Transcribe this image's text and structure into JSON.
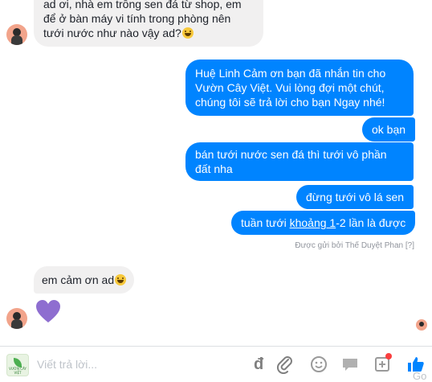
{
  "messages": {
    "incoming_1": {
      "line1": "ad ơi, nhà em trồng sen đá từ shop, em",
      "line2": "để ở bàn máy vi tính trong phòng nên",
      "line3": "tưới nước như nào vậy ad?"
    },
    "outgoing": [
      {
        "lines": [
          "Huệ Linh Cảm ơn bạn đã nhắn tin cho",
          "Vườn Cây Việt. Vui lòng đợi một chút,",
          "chúng tôi sẽ trả lời cho bạn Ngay nhé!"
        ]
      },
      {
        "lines": [
          "ok bạn"
        ]
      },
      {
        "lines": [
          "bán tưới nước sen đá thì tưới vô phần",
          "đất nha"
        ]
      },
      {
        "lines": [
          "đừng tưới vô lá sen"
        ]
      }
    ],
    "last_outgoing": {
      "before": "tuần tưới ",
      "underlined": "khoảng 1",
      "after": "-2 lần là được"
    },
    "sent_by": "Được gửi bởi Thế Duyệt Phan",
    "sent_by_help": "[?]",
    "incoming_2": "em cảm ơn ad"
  },
  "composer": {
    "placeholder": "Viết trả lời...",
    "d_label": "đ",
    "overflow_text": "Go"
  },
  "icons": {
    "emoji": "smiley-emoji",
    "heart": "purple-heart",
    "attach": "paperclip-icon",
    "smiley": "smiley-icon",
    "sticker": "sticker-icon",
    "saved_reply": "speech-bubble-icon",
    "add": "plus-box-icon",
    "like": "thumbs-up-icon"
  },
  "colors": {
    "outgoing_bubble": "#0084ff",
    "incoming_bubble": "#f1f0f0",
    "heart": "#8e6ed0",
    "like": "#0084ff"
  }
}
